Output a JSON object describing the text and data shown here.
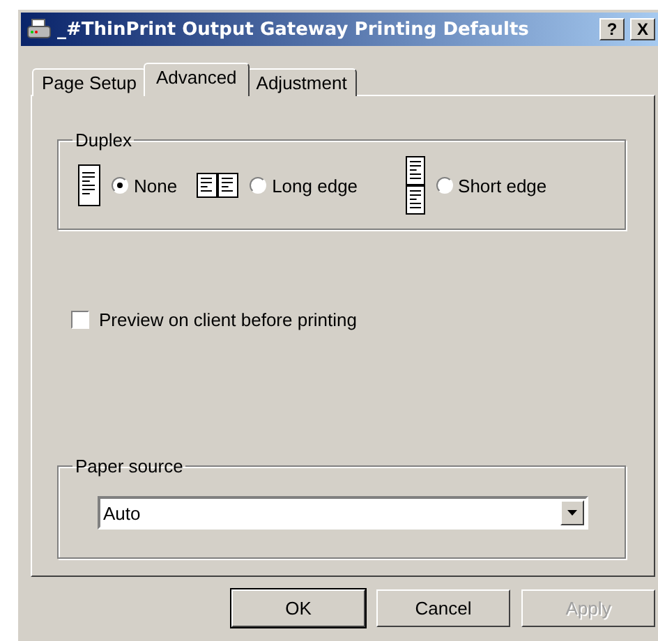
{
  "window": {
    "title": "_#ThinPrint Output Gateway Printing Defaults",
    "help": "?",
    "close": "X"
  },
  "tabs": [
    {
      "label": "Page Setup",
      "selected": false
    },
    {
      "label": "Advanced",
      "selected": true
    },
    {
      "label": "Adjustment",
      "selected": false
    }
  ],
  "duplex": {
    "label": "Duplex",
    "options": [
      {
        "kind": "none",
        "label": "None",
        "selected": true
      },
      {
        "kind": "long",
        "label": "Long edge",
        "selected": false
      },
      {
        "kind": "short",
        "label": "Short edge",
        "selected": false
      }
    ]
  },
  "preview": {
    "label": "Preview on client before printing",
    "checked": false
  },
  "paper_source": {
    "label": "Paper source",
    "value": "Auto"
  },
  "buttons": [
    {
      "label": "OK",
      "disabled": false,
      "default": true
    },
    {
      "label": "Cancel",
      "disabled": false,
      "default": false
    },
    {
      "label": "Apply",
      "disabled": true,
      "default": false
    }
  ]
}
